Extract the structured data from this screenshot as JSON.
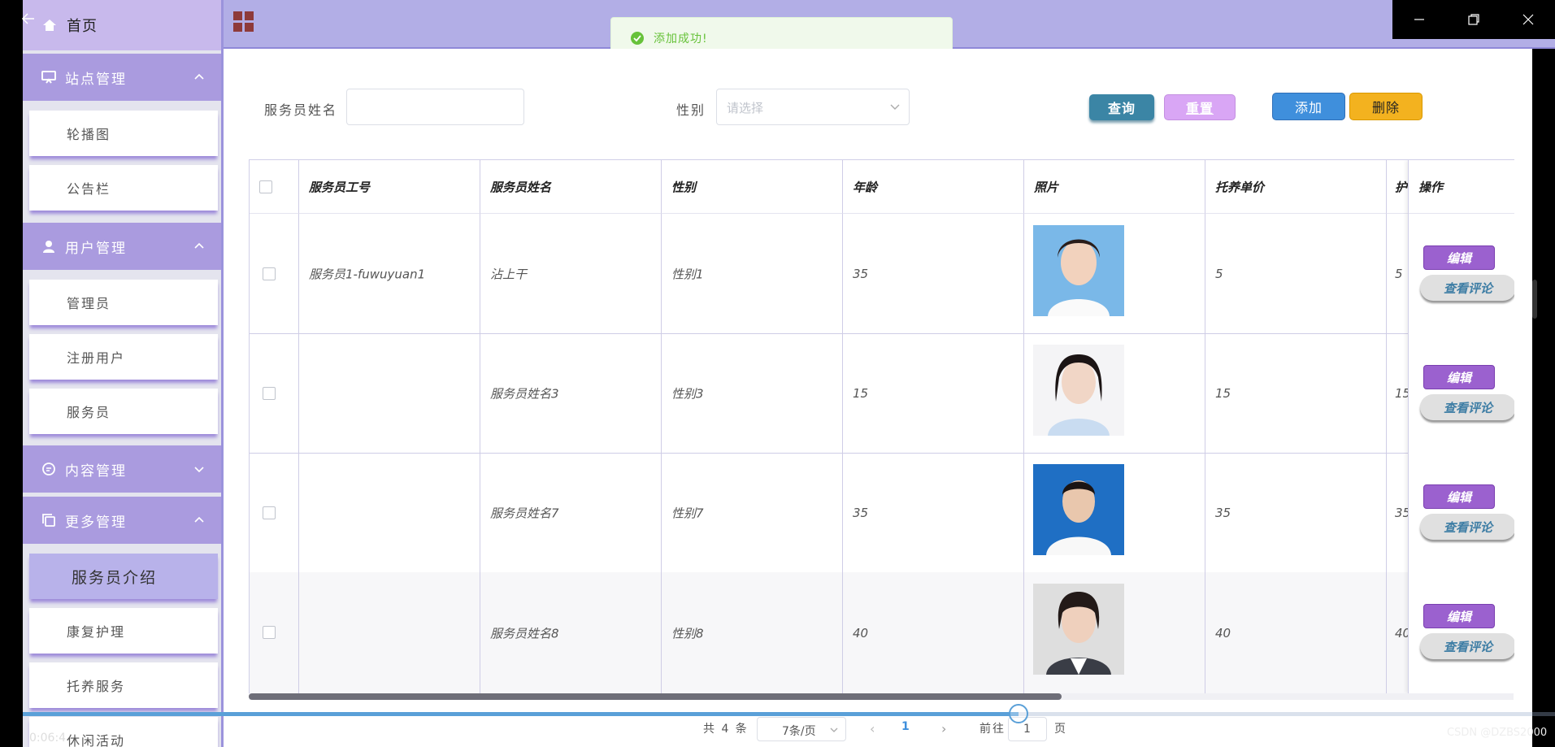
{
  "sidebar": {
    "home_label": "首页",
    "groups": [
      {
        "label": "站点管理",
        "children": [
          "轮播图",
          "公告栏"
        ]
      },
      {
        "label": "用户管理",
        "children": [
          "管理员",
          "注册用户",
          "服务员"
        ]
      },
      {
        "label": "内容管理",
        "children": []
      },
      {
        "label": "更多管理",
        "children": [
          "服务员介绍",
          "康复护理",
          "托养服务",
          "休闲活动"
        ]
      }
    ],
    "active_item": "服务员介绍"
  },
  "toast": {
    "message": "添加成功!",
    "color": "#67c23a"
  },
  "filters": {
    "name_label": "服务员姓名",
    "name_value": "",
    "gender_label": "性别",
    "gender_placeholder": "请选择"
  },
  "buttons": {
    "query": "查询",
    "reset": "重置",
    "add": "添加",
    "delete": "删除"
  },
  "table": {
    "columns": [
      "服务员工号",
      "服务员姓名",
      "性别",
      "年龄",
      "照片",
      "托养单价",
      "护",
      "操作"
    ],
    "rows": [
      {
        "id": "服务员1-fuwuyuan1",
        "name": "沾上干",
        "gender": "性别1",
        "age": "35",
        "price": "5",
        "extra": "5"
      },
      {
        "id": "",
        "name": "服务员姓名3",
        "gender": "性别3",
        "age": "15",
        "price": "15",
        "extra": "15"
      },
      {
        "id": "",
        "name": "服务员姓名7",
        "gender": "性别7",
        "age": "35",
        "price": "35",
        "extra": "35"
      },
      {
        "id": "",
        "name": "服务员姓名8",
        "gender": "性别8",
        "age": "40",
        "price": "40",
        "extra": "40"
      }
    ],
    "edit_label": "编辑",
    "comment_label": "查看评论"
  },
  "pagination": {
    "total": "共 4 条",
    "page_size": "7条/页",
    "current_page": "1",
    "goto_label": "前往",
    "goto_value": "1",
    "page_suffix": "页"
  },
  "video": {
    "time": "0:06:4",
    "progress": 0.65
  },
  "watermark": "CSDN @DZBS2000",
  "colors": {
    "sidebar_group": "#aa9bdf",
    "topbar": "#b2aee6",
    "edit": "#9b61cf",
    "query": "#3b85a5"
  }
}
